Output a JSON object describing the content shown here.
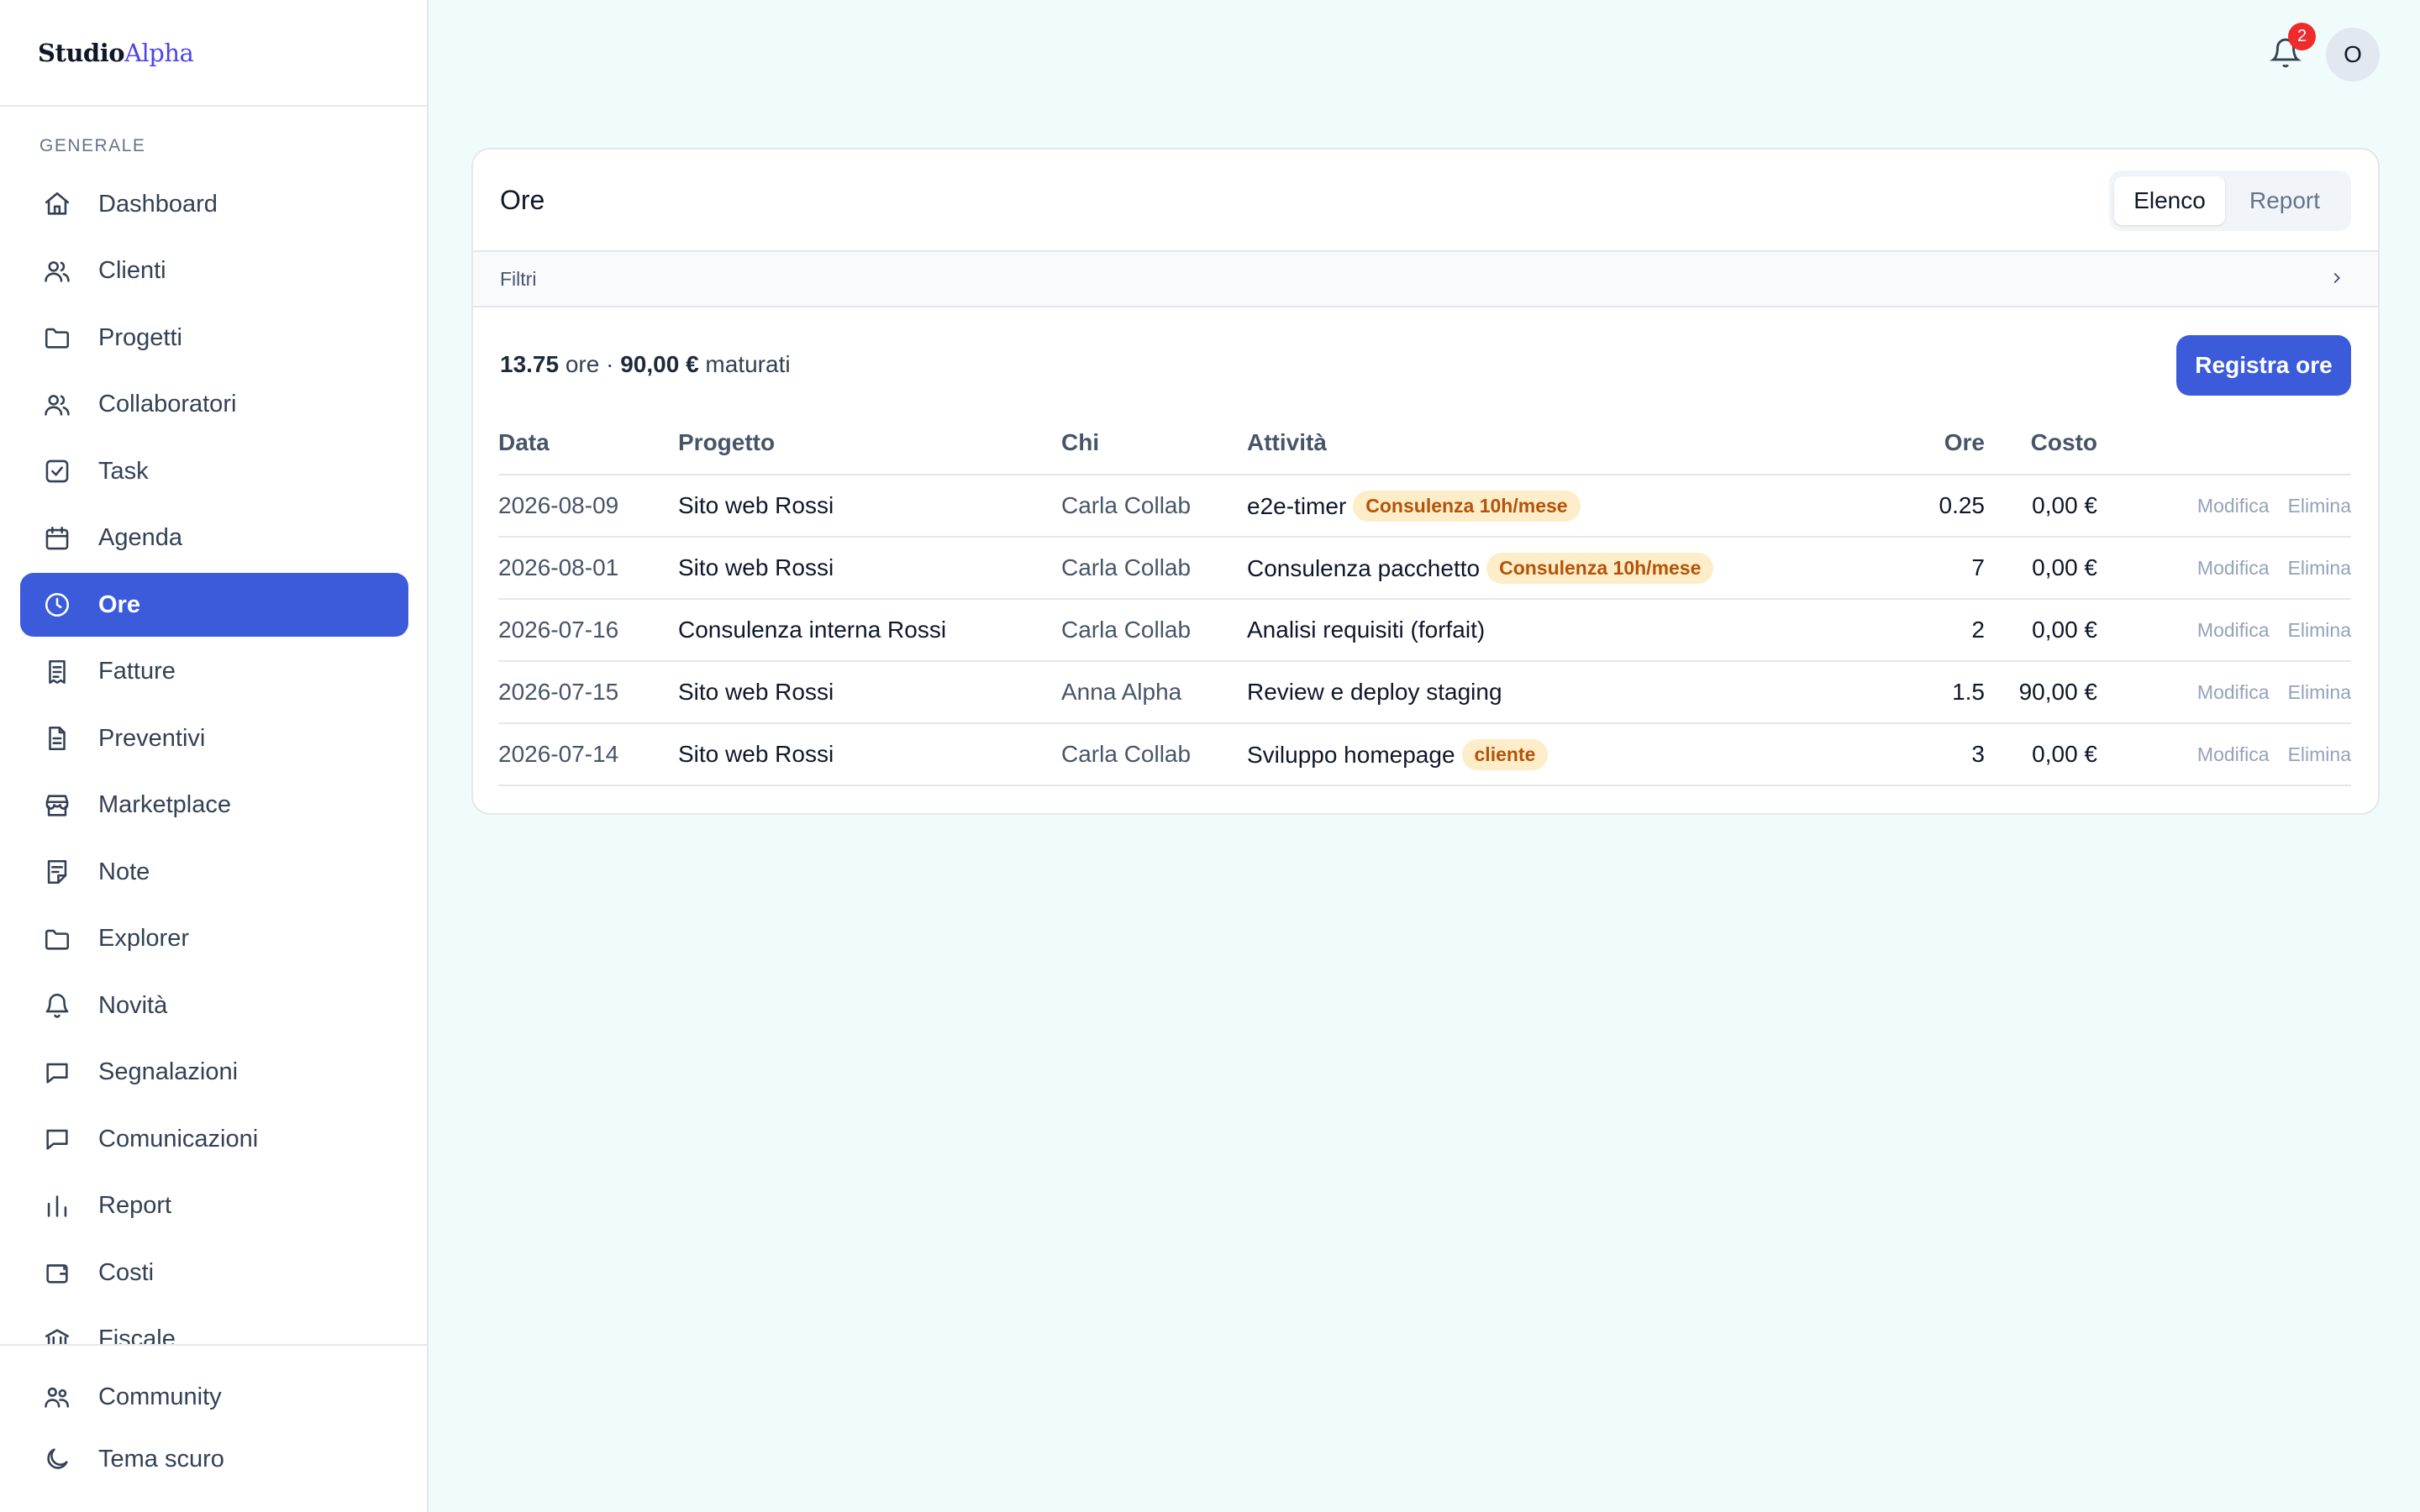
{
  "brand": {
    "part1": "Studio",
    "part2": "Alpha"
  },
  "sidebar": {
    "section_label": "GENERALE",
    "items": [
      {
        "label": "Dashboard",
        "icon": "home-icon"
      },
      {
        "label": "Clienti",
        "icon": "users-icon"
      },
      {
        "label": "Progetti",
        "icon": "folder-icon"
      },
      {
        "label": "Collaboratori",
        "icon": "users-icon"
      },
      {
        "label": "Task",
        "icon": "checkbox-icon"
      },
      {
        "label": "Agenda",
        "icon": "calendar-icon"
      },
      {
        "label": "Ore",
        "icon": "clock-icon",
        "active": true
      },
      {
        "label": "Fatture",
        "icon": "receipt-icon"
      },
      {
        "label": "Preventivi",
        "icon": "document-icon"
      },
      {
        "label": "Marketplace",
        "icon": "store-icon"
      },
      {
        "label": "Note",
        "icon": "note-icon"
      },
      {
        "label": "Explorer",
        "icon": "folder-icon"
      },
      {
        "label": "Novità",
        "icon": "bell-icon"
      },
      {
        "label": "Segnalazioni",
        "icon": "chat-icon"
      },
      {
        "label": "Comunicazioni",
        "icon": "chat-icon"
      },
      {
        "label": "Report",
        "icon": "bar-chart-icon"
      },
      {
        "label": "Costi",
        "icon": "wallet-icon"
      },
      {
        "label": "Fiscale",
        "icon": "bank-icon"
      }
    ],
    "bottom": [
      {
        "label": "Community",
        "icon": "community-icon"
      },
      {
        "label": "Tema scuro",
        "icon": "moon-icon"
      }
    ]
  },
  "topbar": {
    "notifications_count": "2",
    "avatar_initial": "O"
  },
  "card": {
    "title": "Ore",
    "views": [
      "Elenco",
      "Report"
    ],
    "filters_label": "Filtri",
    "summary": {
      "hours": "13.75",
      "hours_unit": "ore",
      "sep": "·",
      "amount": "90,00 €",
      "amount_suffix": "maturati"
    },
    "register_button": "Registra ore",
    "columns": [
      "Data",
      "Progetto",
      "Chi",
      "Attività",
      "Ore",
      "Costo"
    ],
    "rows": [
      {
        "date": "2026-08-09",
        "project": "Sito web Rossi",
        "who": "Carla Collab",
        "activity": "e2e-timer",
        "tag": "Consulenza 10h/mese",
        "hours": "0.25",
        "cost": "0,00 €"
      },
      {
        "date": "2026-08-01",
        "project": "Sito web Rossi",
        "who": "Carla Collab",
        "activity": "Consulenza pacchetto",
        "tag": "Consulenza 10h/mese",
        "hours": "7",
        "cost": "0,00 €"
      },
      {
        "date": "2026-07-16",
        "project": "Consulenza interna Rossi",
        "who": "Carla Collab",
        "activity": "Analisi requisiti (forfait)",
        "tag": "",
        "hours": "2",
        "cost": "0,00 €"
      },
      {
        "date": "2026-07-15",
        "project": "Sito web Rossi",
        "who": "Anna Alpha",
        "activity": "Review e deploy staging",
        "tag": "",
        "hours": "1.5",
        "cost": "90,00 €"
      },
      {
        "date": "2026-07-14",
        "project": "Sito web Rossi",
        "who": "Carla Collab",
        "activity": "Sviluppo homepage",
        "tag": "cliente",
        "hours": "3",
        "cost": "0,00 €"
      }
    ],
    "row_actions": {
      "edit": "Modifica",
      "delete": "Elimina"
    }
  },
  "colors": {
    "primary": "#3b5bdb",
    "background": "#f0fbfb",
    "tag_bg": "#fdedc8",
    "tag_text": "#b45309",
    "badge": "#ef2b2b"
  }
}
